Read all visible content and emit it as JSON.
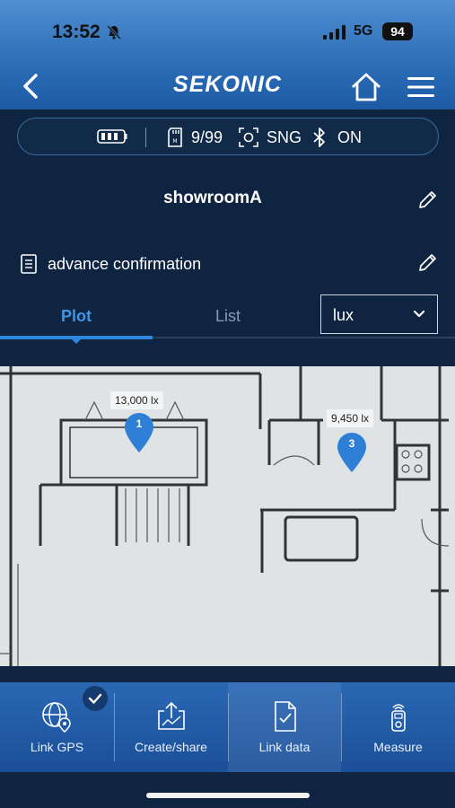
{
  "status_bar": {
    "time": "13:52",
    "network": "5G",
    "battery": "94"
  },
  "header": {
    "brand": "SEKONIC"
  },
  "device_status": {
    "memory": "9/99",
    "mode": "SNG",
    "bluetooth": "ON"
  },
  "project": {
    "title": "showroomA",
    "note": "advance confirmation"
  },
  "tabs": [
    {
      "label": "Plot"
    },
    {
      "label": "List"
    }
  ],
  "unit_select": {
    "value": "lux"
  },
  "plot_points": [
    {
      "number": "1",
      "reading": "13,000 lx"
    },
    {
      "number": "3",
      "reading": "9,450 lx"
    }
  ],
  "toolbar": [
    {
      "label": "Link GPS"
    },
    {
      "label": "Create/share"
    },
    {
      "label": "Link data"
    },
    {
      "label": "Measure"
    }
  ],
  "colors": {
    "accent": "#2d86e0",
    "header": "#2d6fb9",
    "background": "#0f2440",
    "pin": "#2f7fd6"
  }
}
